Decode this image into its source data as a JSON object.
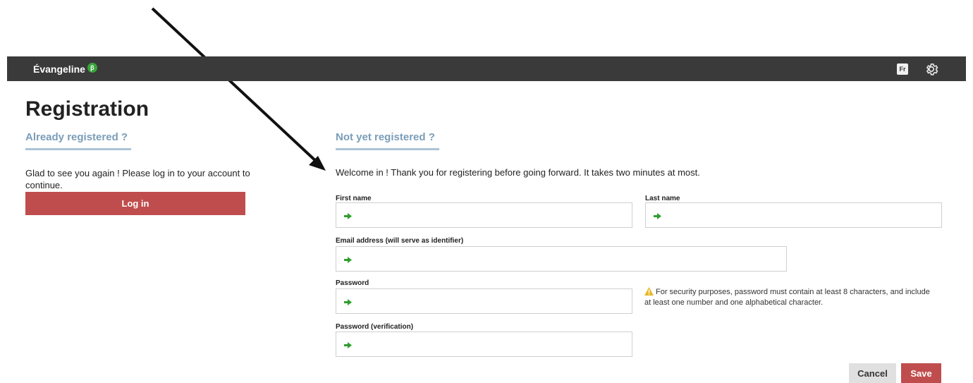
{
  "app": {
    "brand": "Évangeline",
    "beta_badge": "β",
    "language_button": "Fr",
    "settings_icon": "gear-icon"
  },
  "page": {
    "title": "Registration"
  },
  "already_registered": {
    "heading": "Already registered ?",
    "text": "Glad to see you again ! Please log in to your account to continue.",
    "login_label": "Log in"
  },
  "not_registered": {
    "heading": "Not yet registered ?",
    "welcome": "Welcome in ! Thank you for registering before going forward. It takes two minutes at most."
  },
  "form": {
    "first_name": {
      "label": "First name",
      "value": ""
    },
    "last_name": {
      "label": "Last name",
      "value": ""
    },
    "email": {
      "label": "Email address (will serve as identifier)",
      "value": ""
    },
    "password": {
      "label": "Password",
      "value": ""
    },
    "password_verification": {
      "label": "Password (verification)",
      "value": ""
    },
    "password_note": "For security purposes, password must contain at least 8 characters, and include at least one number and one alphabetical character.",
    "field_icon": "arrow-right-icon",
    "warning_icon": "warning-icon"
  },
  "actions": {
    "cancel_label": "Cancel",
    "save_label": "Save"
  },
  "colors": {
    "topbar": "#3a3a3a",
    "accent_red": "#c04d4d",
    "section_blue": "#7a9db8",
    "field_arrow_green": "#2e9e2e",
    "beta_green": "#3aa53a",
    "warning_yellow": "#e8b82a"
  }
}
